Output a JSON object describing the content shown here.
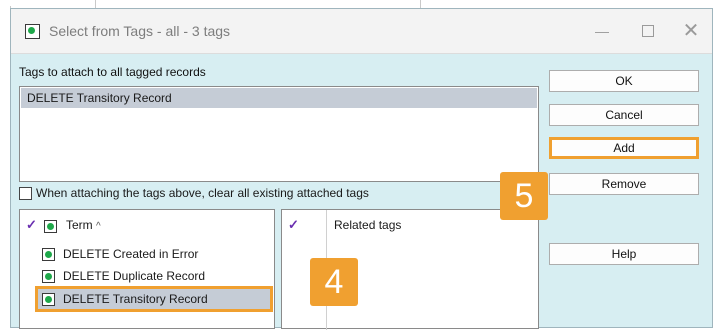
{
  "window": {
    "title": "Select from Tags - all - 3 tags",
    "minimize_glyph": "—",
    "close_glyph": "✕"
  },
  "attach": {
    "label": "Tags to attach to all tagged records",
    "items": [
      "DELETE Transitory Record"
    ]
  },
  "option": {
    "clear_label": "When attaching the tags above, clear all existing attached tags",
    "checked": false
  },
  "term_panel": {
    "header": "Term",
    "sort_glyph": "^",
    "check_glyph": "✓",
    "items": [
      "DELETE Created in Error",
      "DELETE Duplicate Record",
      "DELETE Transitory Record"
    ],
    "selected_index": 2
  },
  "related_panel": {
    "header": "Related tags",
    "check_glyph": "✓"
  },
  "buttons": {
    "ok": "OK",
    "cancel": "Cancel",
    "add": "Add",
    "remove": "Remove",
    "help": "Help"
  },
  "callouts": {
    "step4": "4",
    "step5": "5",
    "color": "#f0a030"
  },
  "colors": {
    "dialog_bg": "#d7eef2",
    "selection": "#c5ccd6",
    "tag_icon_green": "#1ea84a"
  }
}
